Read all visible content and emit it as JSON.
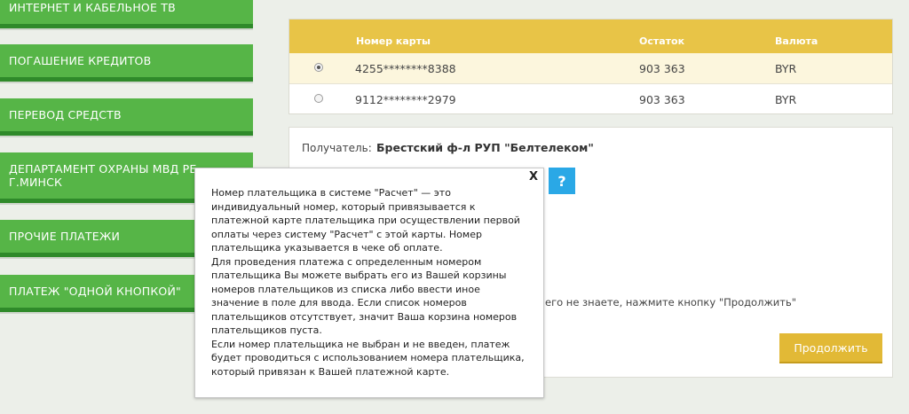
{
  "sidebar": {
    "items": [
      {
        "label": "ИНТЕРНЕТ И КАБЕЛЬНОЕ ТВ"
      },
      {
        "label": "ПОГАШЕНИЕ КРЕДИТОВ"
      },
      {
        "label": "ПЕРЕВОД СРЕДСТВ"
      },
      {
        "label_line1": "ДЕПАРТАМЕНТ ОХРАНЫ МВД РБ",
        "label_line2": "Г.МИНСК"
      },
      {
        "label": "ПРОЧИЕ ПЛАТЕЖИ"
      },
      {
        "label": "ПЛАТЕЖ \"ОДНОЙ КНОПКОЙ\""
      }
    ]
  },
  "cards": {
    "headers": {
      "number": "Номер карты",
      "balance": "Остаток",
      "currency": "Валюта"
    },
    "rows": [
      {
        "number": "4255********8388",
        "balance": "903 363",
        "currency": "BYR",
        "selected": true
      },
      {
        "number": "9112********2979",
        "balance": "903 363",
        "currency": "BYR",
        "selected": false
      }
    ]
  },
  "form": {
    "recipient_label": "Получатель:",
    "recipient_value": "Брестский ф-л РУП \"Белтелеком\"",
    "help_label": "?",
    "hint": "его не знаете, нажмите кнопку \"Продолжить\"",
    "continue_label": "Продолжить"
  },
  "popup": {
    "close_label": "X",
    "lines": [
      "Номер плательщика в системе \"Расчет\" — это",
      "индивидуальный номер, который привязывается к",
      "платежной карте плательщика при осуществлении первой",
      "оплаты через систему \"Расчет\" с этой карты. Номер",
      "плательщика указывается в чеке об оплате.",
      "Для проведения платежа с определенным номером",
      "плательщика Вы можете выбрать его из Вашей корзины",
      "номеров плательщиков из списка либо ввести иное",
      "значение в поле для ввода. Если список номеров",
      "плательщиков отсутствует, значит Ваша корзина номеров",
      "плательщиков пуста.",
      "Если номер плательщика не выбран и не введен, платеж",
      "будет проводиться с использованием номера плательщика,",
      "который привязан к Вашей платежной карте."
    ]
  },
  "colors": {
    "sidebar_green": "#56b547",
    "table_header_gold": "#e8c447",
    "help_blue": "#2aa8e6",
    "continue_gold": "#e2b936"
  }
}
